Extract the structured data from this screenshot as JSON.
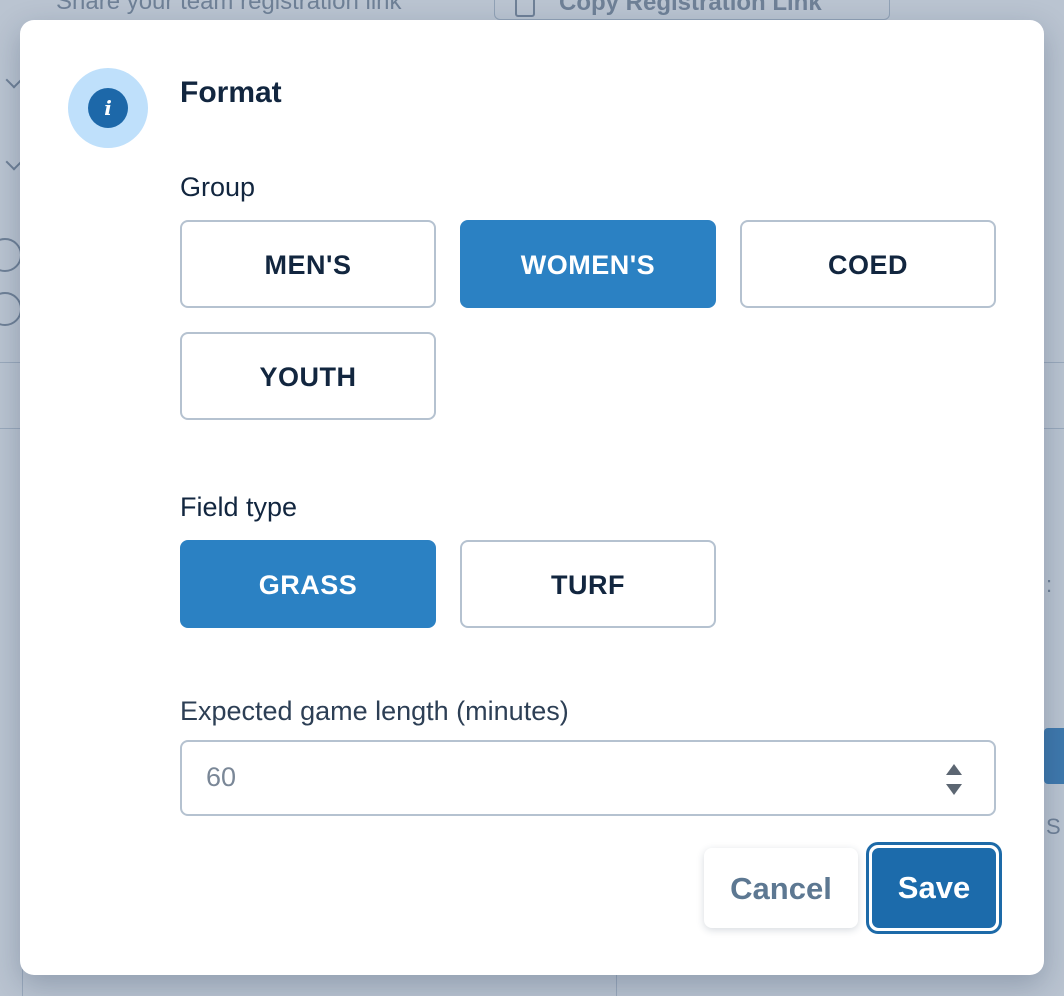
{
  "background": {
    "share_text": "Share your team registration link",
    "copy_button_label": "Copy Registration Link"
  },
  "modal": {
    "icon": "info-icon",
    "icon_glyph": "i",
    "title": "Format",
    "group": {
      "label": "Group",
      "options": [
        "MEN'S",
        "WOMEN'S",
        "COED",
        "YOUTH"
      ],
      "selected": "WOMEN'S"
    },
    "field_type": {
      "label": "Field type",
      "options": [
        "GRASS",
        "TURF"
      ],
      "selected": "GRASS"
    },
    "game_length": {
      "label": "Expected game length (minutes)",
      "value": "60"
    },
    "actions": {
      "cancel_label": "Cancel",
      "save_label": "Save"
    }
  },
  "colors": {
    "selected_bg": "#2b81c3",
    "save_bg": "#1c6bab",
    "info_badge_bg": "#bfe0fb",
    "text_dark": "#12263f"
  }
}
